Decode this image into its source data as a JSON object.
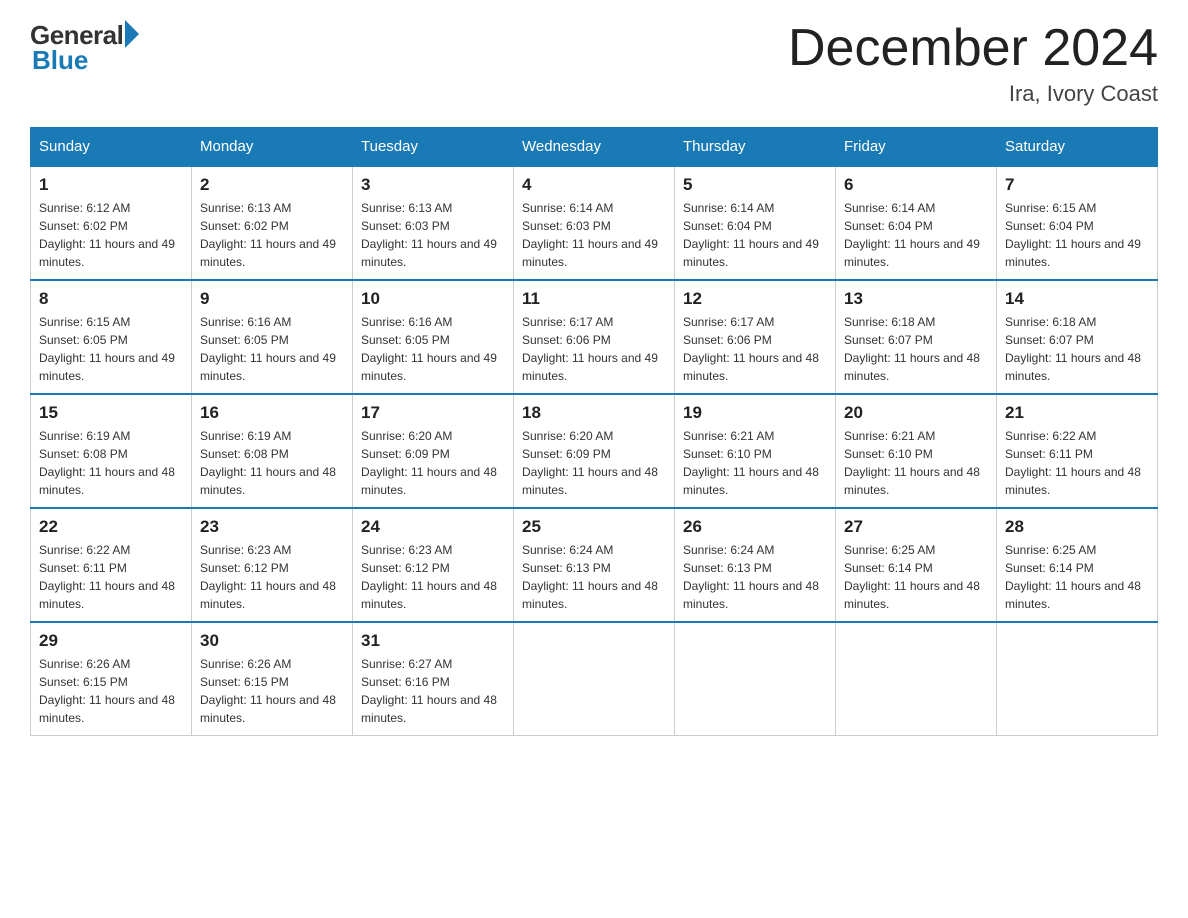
{
  "logo": {
    "general": "General",
    "blue": "Blue"
  },
  "title": {
    "month_year": "December 2024",
    "location": "Ira, Ivory Coast"
  },
  "days_of_week": [
    "Sunday",
    "Monday",
    "Tuesday",
    "Wednesday",
    "Thursday",
    "Friday",
    "Saturday"
  ],
  "weeks": [
    [
      {
        "day": "1",
        "sunrise": "6:12 AM",
        "sunset": "6:02 PM",
        "daylight": "11 hours and 49 minutes."
      },
      {
        "day": "2",
        "sunrise": "6:13 AM",
        "sunset": "6:02 PM",
        "daylight": "11 hours and 49 minutes."
      },
      {
        "day": "3",
        "sunrise": "6:13 AM",
        "sunset": "6:03 PM",
        "daylight": "11 hours and 49 minutes."
      },
      {
        "day": "4",
        "sunrise": "6:14 AM",
        "sunset": "6:03 PM",
        "daylight": "11 hours and 49 minutes."
      },
      {
        "day": "5",
        "sunrise": "6:14 AM",
        "sunset": "6:04 PM",
        "daylight": "11 hours and 49 minutes."
      },
      {
        "day": "6",
        "sunrise": "6:14 AM",
        "sunset": "6:04 PM",
        "daylight": "11 hours and 49 minutes."
      },
      {
        "day": "7",
        "sunrise": "6:15 AM",
        "sunset": "6:04 PM",
        "daylight": "11 hours and 49 minutes."
      }
    ],
    [
      {
        "day": "8",
        "sunrise": "6:15 AM",
        "sunset": "6:05 PM",
        "daylight": "11 hours and 49 minutes."
      },
      {
        "day": "9",
        "sunrise": "6:16 AM",
        "sunset": "6:05 PM",
        "daylight": "11 hours and 49 minutes."
      },
      {
        "day": "10",
        "sunrise": "6:16 AM",
        "sunset": "6:05 PM",
        "daylight": "11 hours and 49 minutes."
      },
      {
        "day": "11",
        "sunrise": "6:17 AM",
        "sunset": "6:06 PM",
        "daylight": "11 hours and 49 minutes."
      },
      {
        "day": "12",
        "sunrise": "6:17 AM",
        "sunset": "6:06 PM",
        "daylight": "11 hours and 48 minutes."
      },
      {
        "day": "13",
        "sunrise": "6:18 AM",
        "sunset": "6:07 PM",
        "daylight": "11 hours and 48 minutes."
      },
      {
        "day": "14",
        "sunrise": "6:18 AM",
        "sunset": "6:07 PM",
        "daylight": "11 hours and 48 minutes."
      }
    ],
    [
      {
        "day": "15",
        "sunrise": "6:19 AM",
        "sunset": "6:08 PM",
        "daylight": "11 hours and 48 minutes."
      },
      {
        "day": "16",
        "sunrise": "6:19 AM",
        "sunset": "6:08 PM",
        "daylight": "11 hours and 48 minutes."
      },
      {
        "day": "17",
        "sunrise": "6:20 AM",
        "sunset": "6:09 PM",
        "daylight": "11 hours and 48 minutes."
      },
      {
        "day": "18",
        "sunrise": "6:20 AM",
        "sunset": "6:09 PM",
        "daylight": "11 hours and 48 minutes."
      },
      {
        "day": "19",
        "sunrise": "6:21 AM",
        "sunset": "6:10 PM",
        "daylight": "11 hours and 48 minutes."
      },
      {
        "day": "20",
        "sunrise": "6:21 AM",
        "sunset": "6:10 PM",
        "daylight": "11 hours and 48 minutes."
      },
      {
        "day": "21",
        "sunrise": "6:22 AM",
        "sunset": "6:11 PM",
        "daylight": "11 hours and 48 minutes."
      }
    ],
    [
      {
        "day": "22",
        "sunrise": "6:22 AM",
        "sunset": "6:11 PM",
        "daylight": "11 hours and 48 minutes."
      },
      {
        "day": "23",
        "sunrise": "6:23 AM",
        "sunset": "6:12 PM",
        "daylight": "11 hours and 48 minutes."
      },
      {
        "day": "24",
        "sunrise": "6:23 AM",
        "sunset": "6:12 PM",
        "daylight": "11 hours and 48 minutes."
      },
      {
        "day": "25",
        "sunrise": "6:24 AM",
        "sunset": "6:13 PM",
        "daylight": "11 hours and 48 minutes."
      },
      {
        "day": "26",
        "sunrise": "6:24 AM",
        "sunset": "6:13 PM",
        "daylight": "11 hours and 48 minutes."
      },
      {
        "day": "27",
        "sunrise": "6:25 AM",
        "sunset": "6:14 PM",
        "daylight": "11 hours and 48 minutes."
      },
      {
        "day": "28",
        "sunrise": "6:25 AM",
        "sunset": "6:14 PM",
        "daylight": "11 hours and 48 minutes."
      }
    ],
    [
      {
        "day": "29",
        "sunrise": "6:26 AM",
        "sunset": "6:15 PM",
        "daylight": "11 hours and 48 minutes."
      },
      {
        "day": "30",
        "sunrise": "6:26 AM",
        "sunset": "6:15 PM",
        "daylight": "11 hours and 48 minutes."
      },
      {
        "day": "31",
        "sunrise": "6:27 AM",
        "sunset": "6:16 PM",
        "daylight": "11 hours and 48 minutes."
      },
      null,
      null,
      null,
      null
    ]
  ]
}
